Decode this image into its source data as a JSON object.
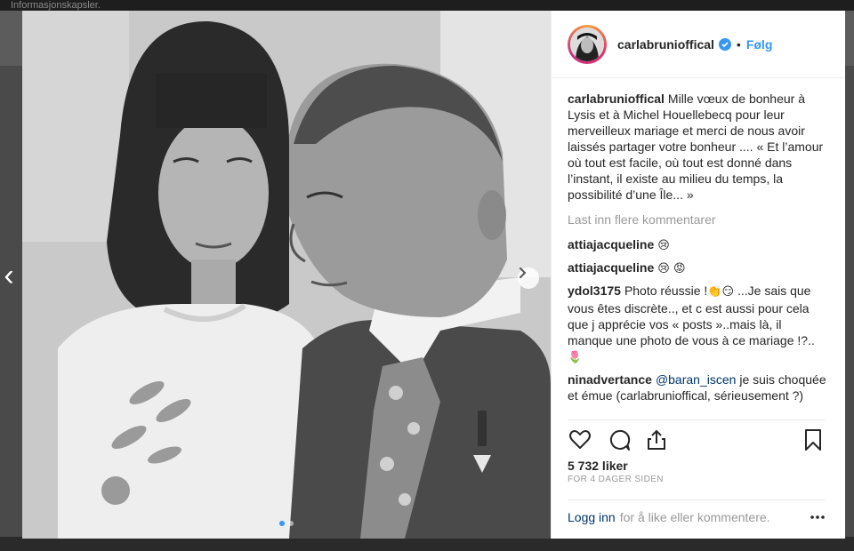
{
  "page": {
    "top_strip_text": "Informasjonskapsler."
  },
  "post": {
    "username": "carlabrunioffical",
    "follow_label": "Følg",
    "caption_user": "carlabrunioffical",
    "caption_text": "Mille vœux de bonheur à Lysis et à Michel Houellebecq pour leur merveilleux mariage et merci de nous avoir laissés partager votre bonheur .... « Et l’amour où tout est facile, où tout est donné dans l’instant, il existe au milieu du temps, la possibilité d’une Île... »",
    "load_more_label": "Last inn flere kommentarer",
    "comments": [
      {
        "user": "attiajacqueline",
        "text": "",
        "emoji": "😢"
      },
      {
        "user": "attiajacqueline",
        "text": "",
        "emoji": "😢 😡"
      },
      {
        "user": "ydol3175",
        "text_a": "Photo réussie !",
        "emoji_a": "👏😏",
        "text_b": " ...Je sais que vous êtes discrète.., et c est aussi pour cela que j apprécie vos « posts »..mais là, il manque une photo de vous à ce mariage !?..",
        "emoji_b": "🌷"
      },
      {
        "user": "ninadvertance",
        "mention": "@baran_iscen",
        "text": " je suis choquée et émue (carlabrunioffical, sérieusement ?)"
      }
    ],
    "likes_text": "5 732 liker",
    "timestamp": "FOR 4 DAGER SIDEN",
    "login_link": "Logg inn",
    "login_text": "for å like eller kommentere.",
    "carousel": {
      "count": 2,
      "active": 1
    },
    "colors": {
      "accent_blue": "#3897f0",
      "text_dark": "#262626",
      "muted": "#999999"
    },
    "icons": [
      "heart-icon",
      "comment-icon",
      "share-icon",
      "bookmark-icon",
      "more-icon",
      "verified-icon",
      "chevron-right-icon",
      "chevron-left-icon"
    ]
  }
}
